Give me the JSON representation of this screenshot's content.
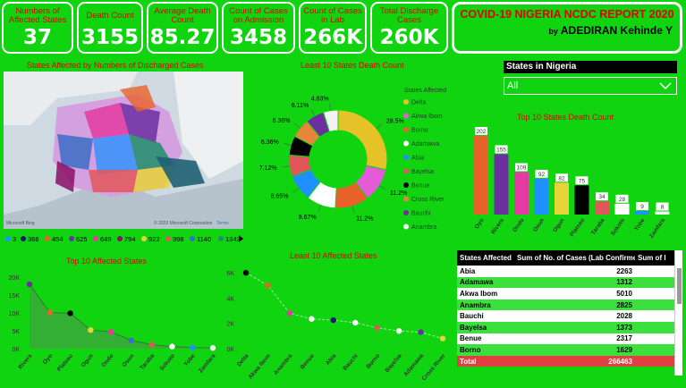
{
  "kpis": [
    {
      "label": "Numbers of Affected States",
      "value": "37"
    },
    {
      "label": "Death Count",
      "value": "3155"
    },
    {
      "label": "Average Death Count",
      "value": "85.27"
    },
    {
      "label": "Count of Cases on Admission",
      "value": "3458"
    },
    {
      "label": "Count of Cases in Lab",
      "value": "266K"
    },
    {
      "label": "Total Discharge Cases",
      "value": "260K"
    }
  ],
  "report": {
    "title": "COVID-19 NIGERIA NCDC REPORT 2020",
    "by": "by",
    "author": "ADEDIRAN Kehinde Y"
  },
  "map": {
    "title": "States Affected by Numbers of Discharged Cases",
    "bing": "Microsoft Bing",
    "copyright": "© 2023 Microsoft Corporation",
    "terms": "Terms",
    "legend": [
      {
        "label": "3",
        "color": "#1e90ff"
      },
      {
        "label": "366",
        "color": "#1a1a6e"
      },
      {
        "label": "454",
        "color": "#e8632b"
      },
      {
        "label": "625",
        "color": "#6b2fa0"
      },
      {
        "label": "649",
        "color": "#e33ba1"
      },
      {
        "label": "794",
        "color": "#8b0f66"
      },
      {
        "label": "922",
        "color": "#e6d33a"
      },
      {
        "label": "998",
        "color": "#e15759"
      },
      {
        "label": "1140",
        "color": "#3a6ec4"
      },
      {
        "label": "1343",
        "color": "#1e8f6a"
      }
    ]
  },
  "donut": {
    "title": "Least 10 States Death Count",
    "legend_title": "States Affected",
    "slices": [
      {
        "state": "Delta",
        "pct": 28.5,
        "label": "28.5%",
        "color": "#e6c229"
      },
      {
        "state": "Akwa Ibom",
        "pct": 11.2,
        "label": "11.2%",
        "color": "#e35bd6"
      },
      {
        "state": "Borno",
        "pct": 11.2,
        "label": "11.2%",
        "color": "#e8632b"
      },
      {
        "state": "Adamawa",
        "pct": 9.67,
        "label": "9.67%",
        "color": "#ffffff"
      },
      {
        "state": "Abia",
        "pct": 8.65,
        "label": "8.65%",
        "color": "#1e90ff"
      },
      {
        "state": "Bayelsa",
        "pct": 7.12,
        "label": "7.12%",
        "color": "#e15759"
      },
      {
        "state": "Benue",
        "pct": 6.36,
        "label": "6.36%",
        "color": "#000000"
      },
      {
        "state": "Cross River",
        "pct": 6.36,
        "label": "6.36%",
        "color": "#e8843b"
      },
      {
        "state": "Bauchi",
        "pct": 6.11,
        "label": "6.11%",
        "color": "#6b2fa0"
      },
      {
        "state": "Anambra",
        "pct": 4.83,
        "label": "4.83%",
        "color": "#f2f2f2"
      }
    ]
  },
  "slicer": {
    "title": "States in Nigeria",
    "value": "All"
  },
  "bar_chart": {
    "title": "Top 10 States Death Count",
    "categories": [
      "Oyo",
      "Rivers",
      "Ondo",
      "Osun",
      "Ogun",
      "Plateau",
      "Taraba",
      "Sokoto",
      "Yobe",
      "Zamfara"
    ],
    "values": [
      202,
      155,
      109,
      92,
      82,
      75,
      34,
      28,
      9,
      8
    ],
    "colors": [
      "#e8632b",
      "#6b2fa0",
      "#e33ba1",
      "#1e90ff",
      "#e6d33a",
      "#000000",
      "#e15759",
      "#ffffff",
      "#1e90ff",
      "#f2f2f2"
    ]
  },
  "area_chart": {
    "title": "Top 10 Affected States",
    "categories": [
      "Rivers",
      "Oyo",
      "Plateau",
      "Ogun",
      "Ondo",
      "Osun",
      "Taraba",
      "Sokoto",
      "Yobe",
      "Zamfara"
    ],
    "values": [
      18000,
      10100,
      9900,
      5200,
      4700,
      2300,
      1100,
      600,
      300,
      200
    ],
    "y_ticks": [
      "0K",
      "5K",
      "10K",
      "15K",
      "20K"
    ],
    "ylim": [
      0,
      21000
    ],
    "colors": [
      "#6b2fa0",
      "#e8632b",
      "#000000",
      "#e6d33a",
      "#e33ba1",
      "#3a6ec4",
      "#e15759",
      "#ffffff",
      "#1e90ff",
      "#f2f2f2"
    ]
  },
  "line_chart": {
    "title": "Least 10 Affected States",
    "categories": [
      "Delta",
      "Akwa Ibom",
      "Anambra",
      "Benue",
      "Abia",
      "Bauchi",
      "Borno",
      "Bayelsa",
      "Adamawa",
      "Cross River"
    ],
    "values": [
      6000,
      5000,
      2800,
      2350,
      2250,
      2050,
      1650,
      1400,
      1300,
      800
    ],
    "y_ticks": [
      "0K",
      "2K",
      "4K",
      "6K"
    ],
    "ylim": [
      0,
      6500
    ],
    "colors": [
      "#000000",
      "#e8632b",
      "#e33ba1",
      "#ffffff",
      "#1a1a6e",
      "#ffffff",
      "#e15759",
      "#f2f2f2",
      "#6b2fa0",
      "#e6d33a"
    ]
  },
  "table": {
    "headers": [
      "States Affected",
      "Sum of No. of Cases (Lab Confirmed)",
      "Sum of I"
    ],
    "rows": [
      {
        "state": "Abia",
        "value": "2263"
      },
      {
        "state": "Adamawa",
        "value": "1312"
      },
      {
        "state": "Akwa Ibom",
        "value": "5010"
      },
      {
        "state": "Anambra",
        "value": "2825"
      },
      {
        "state": "Bauchi",
        "value": "2028"
      },
      {
        "state": "Bayelsa",
        "value": "1373"
      },
      {
        "state": "Benue",
        "value": "2317"
      },
      {
        "state": "Borno",
        "value": "1629"
      }
    ],
    "total": {
      "state": "Total",
      "value": "266463"
    }
  }
}
